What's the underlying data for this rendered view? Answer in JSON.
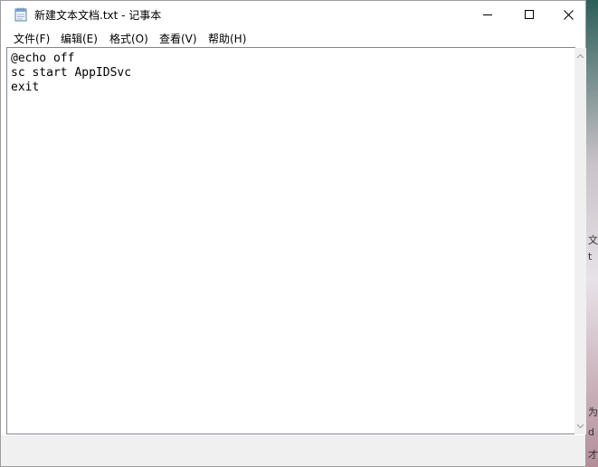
{
  "window": {
    "title": "新建文本文档.txt - 记事本",
    "icon": "notepad-icon",
    "controls": {
      "minimize_icon": "minimize-icon",
      "maximize_icon": "maximize-icon",
      "close_icon": "close-icon"
    }
  },
  "menu": {
    "items": [
      {
        "label": "文件(F)"
      },
      {
        "label": "编辑(E)"
      },
      {
        "label": "格式(O)"
      },
      {
        "label": "查看(V)"
      },
      {
        "label": "帮助(H)"
      }
    ]
  },
  "editor": {
    "lines": [
      "@echo off",
      "sc start AppIDSvc",
      "exit"
    ]
  },
  "background": {
    "edge_glyphs": [
      "文",
      "t",
      "为",
      "d",
      "才"
    ]
  }
}
